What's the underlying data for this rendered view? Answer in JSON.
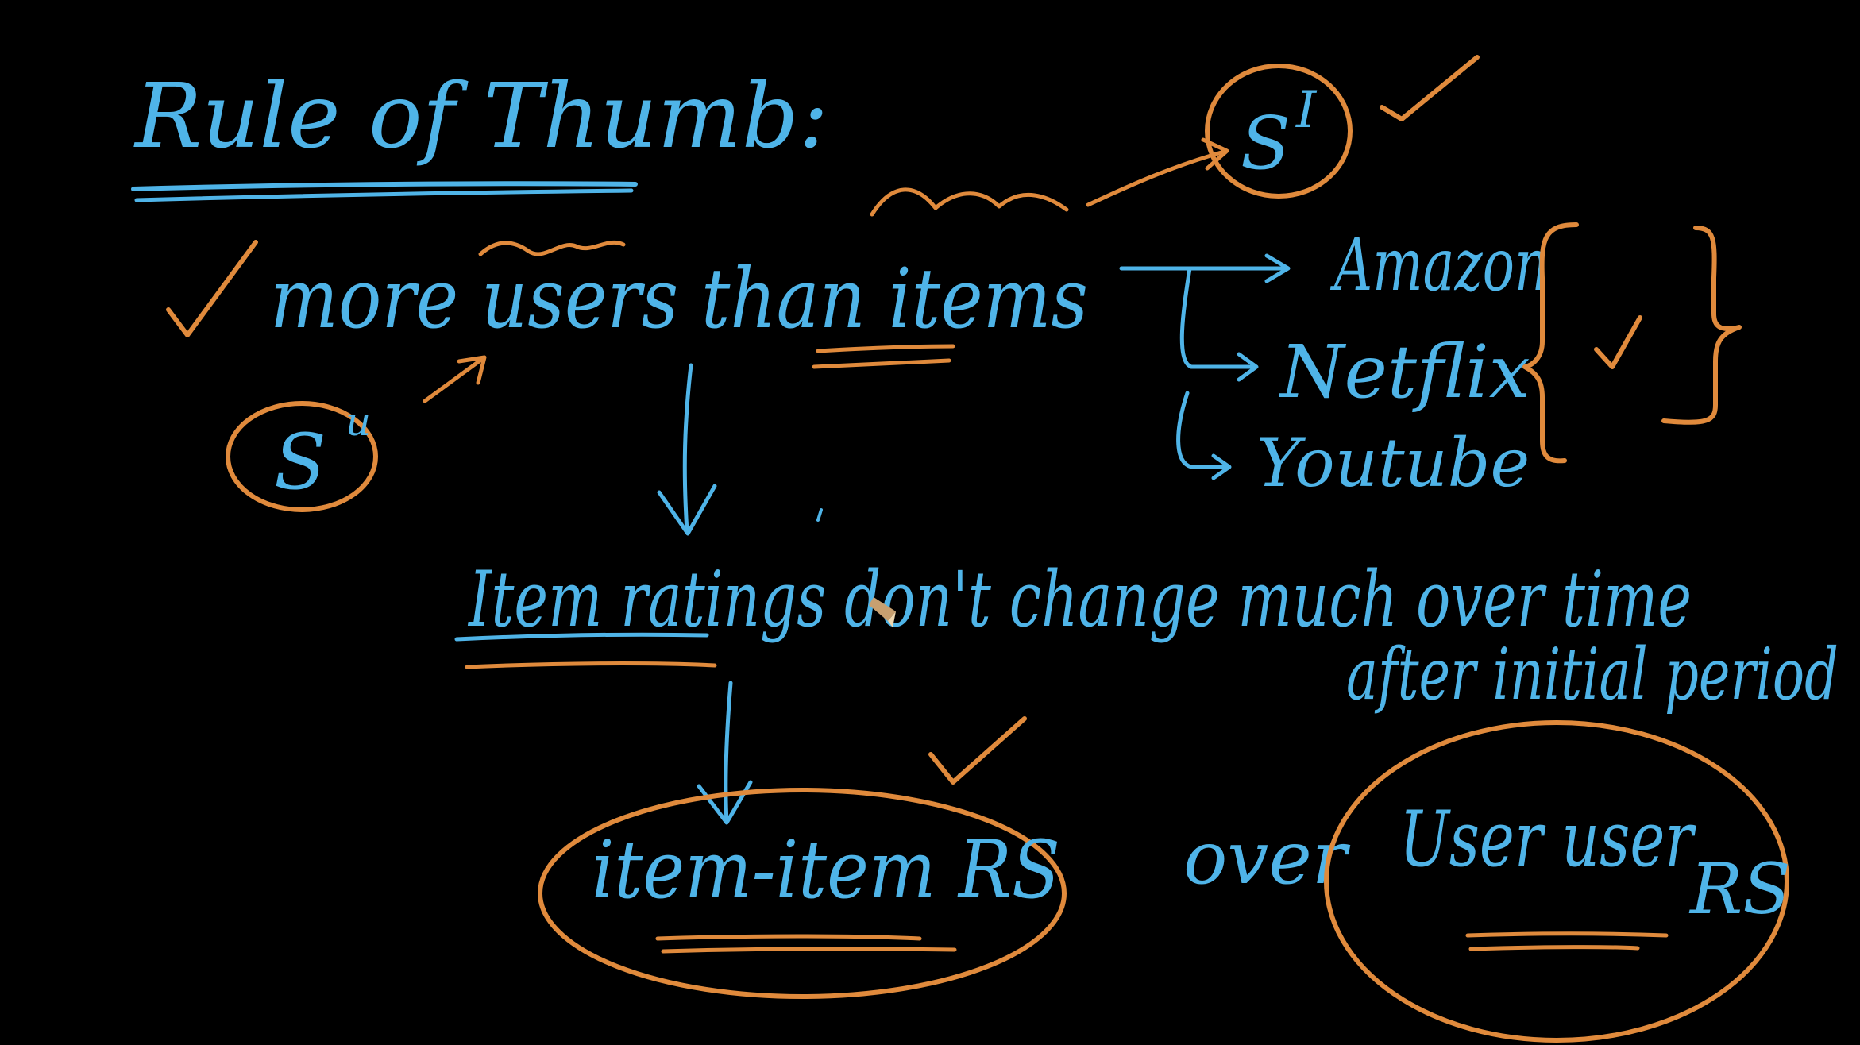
{
  "colors": {
    "background": "#000000",
    "blue_ink": "#4fb4e8",
    "orange_ink": "#e08a3c",
    "cursor": "#c8a070"
  },
  "heading": {
    "text": "Rule of Thumb:"
  },
  "premise": {
    "text": "more users than items"
  },
  "symbols": {
    "user_similarity": "S",
    "user_superscript": "u",
    "item_similarity": "S",
    "item_superscript": "I"
  },
  "examples": [
    "Amazon",
    "Netflix",
    "Youtube"
  ],
  "observation": {
    "line1": "Item ratings don't change much over time",
    "line2": "after initial period"
  },
  "conclusion": {
    "preferred": "item-item RS",
    "connector": "over",
    "alternative_main": "User user",
    "alternative_suffix": "RS"
  },
  "icons": [
    "checkmark-icon",
    "pencil-cursor-icon"
  ]
}
